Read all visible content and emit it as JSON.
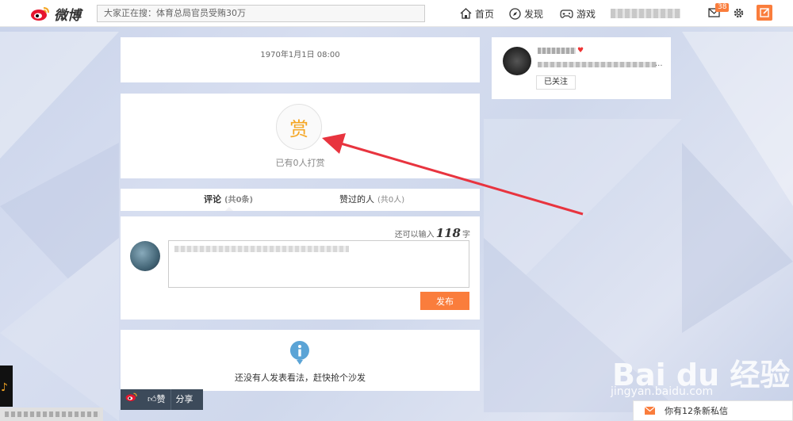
{
  "topbar": {
    "logo_text": "微博",
    "search_placeholder": "大家正在搜：体育总局官员受贿30万",
    "nav": [
      {
        "label": "首页",
        "icon": "home-icon"
      },
      {
        "label": "发现",
        "icon": "compass-icon"
      },
      {
        "label": "游戏",
        "icon": "gamepad-icon"
      }
    ],
    "mail_badge": "38"
  },
  "post": {
    "date": "1970年1月1日 08:00"
  },
  "reward": {
    "glyph": "赏",
    "count_text": "已有0人打赏"
  },
  "tabs": [
    {
      "label": "评论",
      "count": "(共0条)"
    },
    {
      "label": "赞过的人",
      "count": "(共0人)"
    }
  ],
  "comment_box": {
    "remaining_prefix": "还可以输入",
    "remaining_count": "118",
    "remaining_suffix": "字",
    "post_label": "发布"
  },
  "empty_state": {
    "text": "还没有人发表看法，赶快抢个沙发"
  },
  "user_card": {
    "vip_badge": "♥",
    "more": "...",
    "follow_label": "已关注"
  },
  "bottom_bar": {
    "like_label": "赞",
    "share_label": "分享"
  },
  "private_message": {
    "text": "你有12条新私信"
  },
  "watermark": {
    "logo": "Bai du 经验",
    "url": "jingyan.baidu.com"
  },
  "colors": {
    "accent": "#fa7d3c",
    "reward": "#f5a623",
    "arrow": "#e8343f",
    "bottom_bar": "#3c4a5a"
  }
}
